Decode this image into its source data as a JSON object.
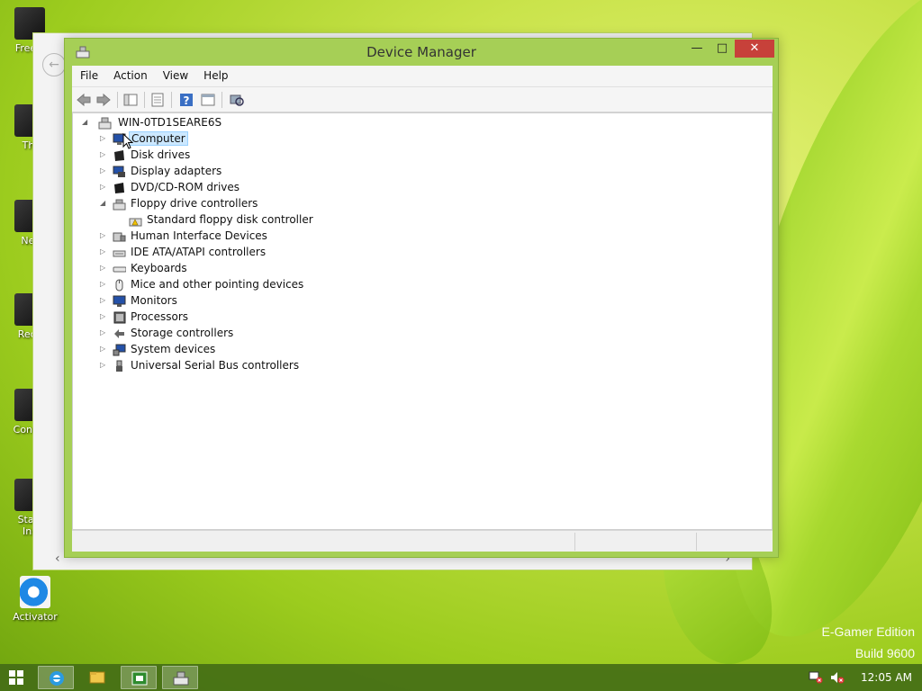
{
  "desktop": {
    "icons": [
      {
        "label": "Freew"
      },
      {
        "label": "Thi"
      },
      {
        "label": "Net"
      },
      {
        "label": "Recy"
      },
      {
        "label": "Contro"
      },
      {
        "label": "Start\nIns"
      },
      {
        "label": "Activator"
      }
    ],
    "watermark_line1": "E-Gamer Edition",
    "watermark_line2": "Build 9600"
  },
  "window": {
    "title": "Device Manager",
    "controls": {
      "minimize": "—",
      "maximize": "□",
      "close": "✕"
    }
  },
  "menu": [
    "File",
    "Action",
    "View",
    "Help"
  ],
  "toolbar": {
    "icons": [
      "back-arrow-icon",
      "forward-arrow-icon",
      "show-hide-tree-icon",
      "properties-icon",
      "help-icon",
      "action-view-icon",
      "scan-hardware-icon"
    ]
  },
  "tree": {
    "root": "WIN-0TD1SEARE6S",
    "items": [
      {
        "label": "Computer",
        "expanded": false,
        "selected": true
      },
      {
        "label": "Disk drives",
        "expanded": false
      },
      {
        "label": "Display adapters",
        "expanded": false
      },
      {
        "label": "DVD/CD-ROM drives",
        "expanded": false
      },
      {
        "label": "Floppy drive controllers",
        "expanded": true
      },
      {
        "label": "Standard floppy disk controller",
        "child": true
      },
      {
        "label": "Human Interface Devices",
        "expanded": false
      },
      {
        "label": "IDE ATA/ATAPI controllers",
        "expanded": false
      },
      {
        "label": "Keyboards",
        "expanded": false
      },
      {
        "label": "Mice and other pointing devices",
        "expanded": false
      },
      {
        "label": "Monitors",
        "expanded": false
      },
      {
        "label": "Processors",
        "expanded": false
      },
      {
        "label": "Storage controllers",
        "expanded": false
      },
      {
        "label": "System devices",
        "expanded": false
      },
      {
        "label": "Universal Serial Bus controllers",
        "expanded": false
      }
    ]
  },
  "taskbar": {
    "apps": [
      "internet-explorer-icon",
      "file-explorer-icon",
      "store-icon",
      "device-manager-icon"
    ],
    "clock": "12:05 AM"
  },
  "colors": {
    "accent": "#a6cf56",
    "close": "#c7413a",
    "selection": "#cce8ff"
  }
}
